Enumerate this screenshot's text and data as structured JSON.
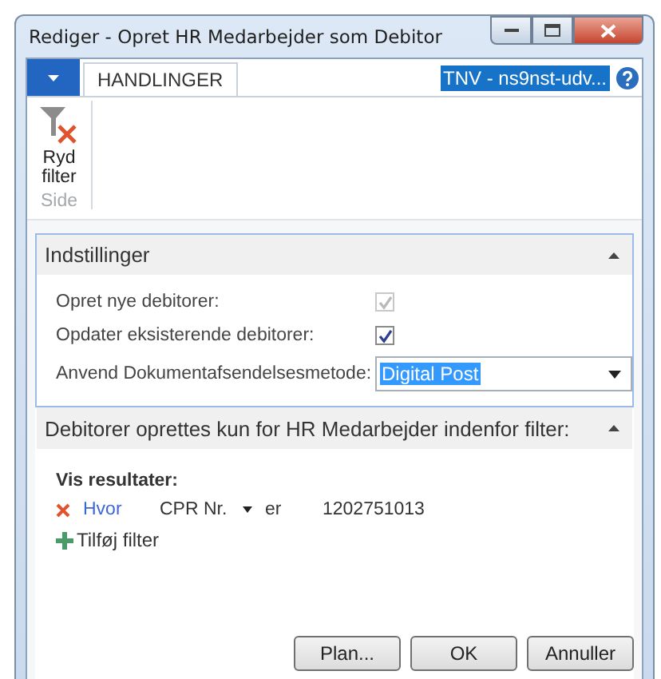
{
  "window": {
    "title": "Rediger - Opret HR Medarbejder som Debitor"
  },
  "ribbon": {
    "tabs": [
      {
        "label": "HANDLINGER",
        "selected": true
      }
    ],
    "company": "TNV - ns9nst-udv...",
    "actions": [
      {
        "label": "Ryd filter"
      }
    ],
    "group": "Side"
  },
  "sections": [
    {
      "title": "Indstillinger",
      "expanded": true,
      "focused": true,
      "fields": [
        {
          "kind": "checkbox",
          "label": "Opret nye debitorer:",
          "checked": true,
          "disabled": true
        },
        {
          "kind": "checkbox",
          "label": "Opdater eksisterende debitorer:",
          "checked": true,
          "disabled": false
        },
        {
          "kind": "dropdown",
          "label": "Anvend Dokumentafsendelsesmetode:",
          "value": "Digital Post"
        }
      ]
    },
    {
      "title": "Debitorer oprettes kun for HR Medarbejder indenfor filter:",
      "expanded": true,
      "focused": false
    }
  ],
  "filter": {
    "heading": "Vis resultater:",
    "rows": [
      {
        "where": "Hvor",
        "field": "CPR Nr.",
        "operator": "er",
        "value": "1202751013"
      }
    ],
    "add": "Tilføj filter"
  },
  "buttons": [
    "Plan...",
    "OK",
    "Annuller"
  ]
}
